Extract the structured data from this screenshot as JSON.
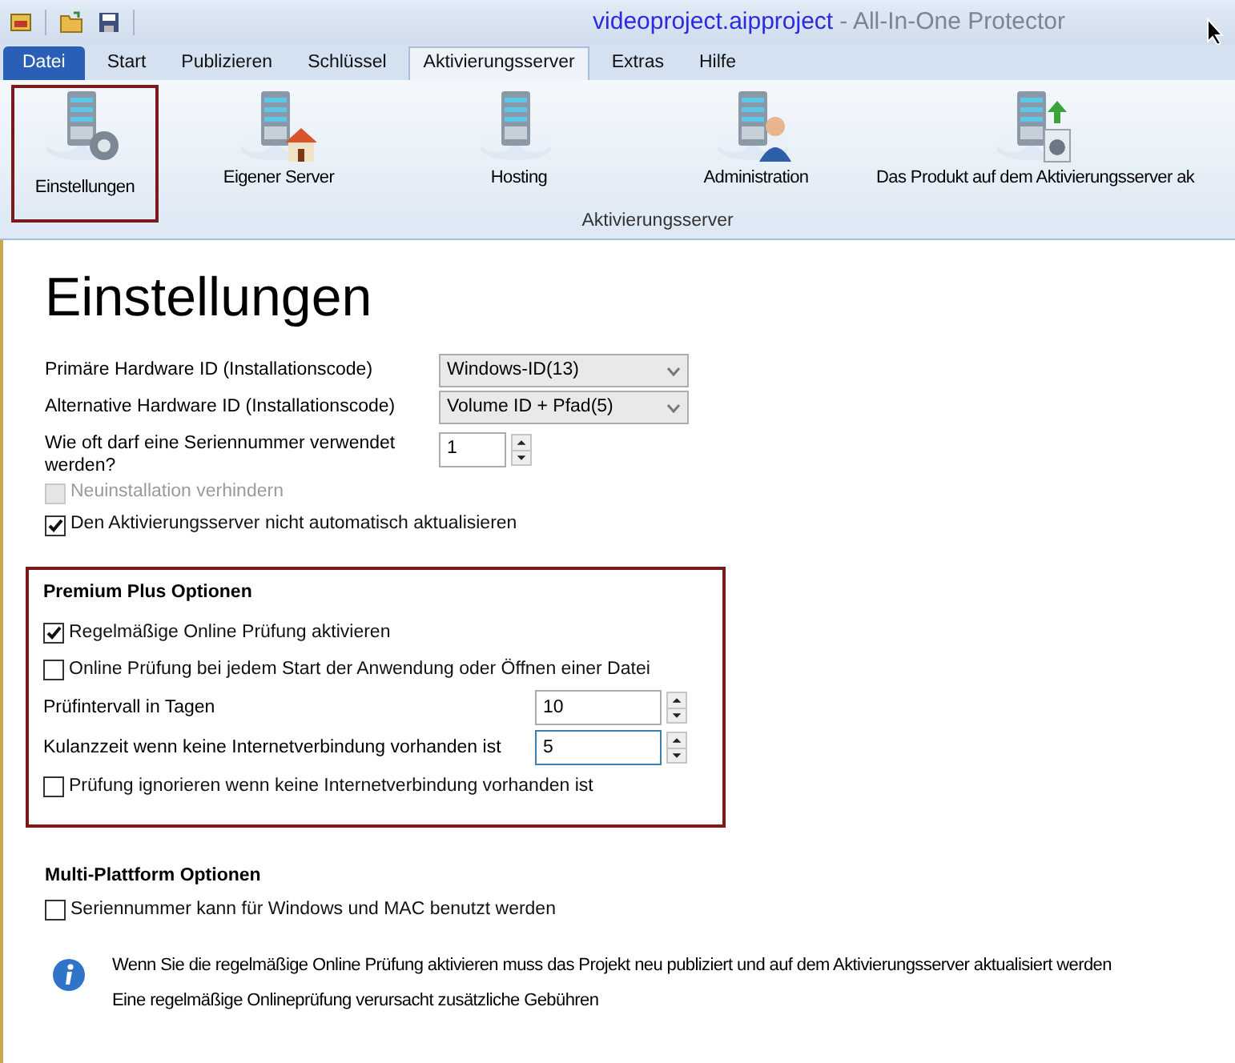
{
  "window": {
    "project": "videoproject.aipproject",
    "app_title": "- All-In-One Protector"
  },
  "menu_tabs": [
    {
      "label": "Datei",
      "kind": "file"
    },
    {
      "label": "Start",
      "kind": "tab",
      "selected": false
    },
    {
      "label": "Publizieren",
      "kind": "tab",
      "selected": false
    },
    {
      "label": "Schlüssel",
      "kind": "tab",
      "selected": false
    },
    {
      "label": "Aktivierungsserver",
      "kind": "tab",
      "selected": true
    },
    {
      "label": "Extras",
      "kind": "tab",
      "selected": false
    },
    {
      "label": "Hilfe",
      "kind": "tab",
      "selected": false
    }
  ],
  "ribbon": {
    "group_label": "Aktivierungsserver",
    "buttons": [
      {
        "label": "Einstellungen",
        "selected": true
      },
      {
        "label": "Eigener Server",
        "selected": false
      },
      {
        "label": "Hosting",
        "selected": false
      },
      {
        "label": "Administration",
        "selected": false
      },
      {
        "label": "Das Produkt auf dem Aktivierungsserver ak",
        "selected": false
      }
    ]
  },
  "page": {
    "heading": "Einstellungen",
    "dropdowns": [
      {
        "label": "Primäre Hardware ID (Installationscode)",
        "value": "Windows-ID(13)"
      },
      {
        "label": "Alternative Hardware ID (Installationscode)",
        "value": "Volume ID + Pfad(5)"
      }
    ],
    "usage": {
      "label": "Wie oft darf eine Seriennummer verwendet werden?",
      "value": "1",
      "focused": false
    },
    "checkboxes": [
      {
        "label": "Neuinstallation verhindern",
        "checked": false,
        "disabled": true
      },
      {
        "label": "Den Aktivierungsserver nicht automatisch aktualisieren",
        "checked": true,
        "disabled": false
      }
    ]
  },
  "premium": {
    "title": "Premium Plus Optionen",
    "items": [
      {
        "kind": "checkbox",
        "label": "Regelmäßige Online Prüfung aktivieren",
        "checked": true
      },
      {
        "kind": "checkbox",
        "label": "Online Prüfung bei jedem Start der Anwendung oder Öffnen einer Datei",
        "checked": false
      },
      {
        "kind": "spin",
        "label": "Prüfintervall in Tagen",
        "value": "10",
        "focused": false
      },
      {
        "kind": "spin",
        "label": "Kulanzzeit wenn keine Internetverbindung vorhanden ist",
        "value": "5",
        "focused": true
      },
      {
        "kind": "checkbox",
        "label": "Prüfung ignorieren wenn keine Internetverbindung vorhanden ist",
        "checked": false
      }
    ]
  },
  "multi": {
    "title": "Multi-Plattform Optionen",
    "checkbox": {
      "label": "Seriennummer kann für Windows und MAC benutzt werden",
      "checked": false
    }
  },
  "info": [
    "Wenn Sie die regelmäßige Online Prüfung aktivieren muss das Projekt neu publiziert und auf dem Aktivierungsserver aktualisiert werden",
    "Eine regelmäßige Onlineprüfung verursacht zusätzliche Gebühren"
  ]
}
